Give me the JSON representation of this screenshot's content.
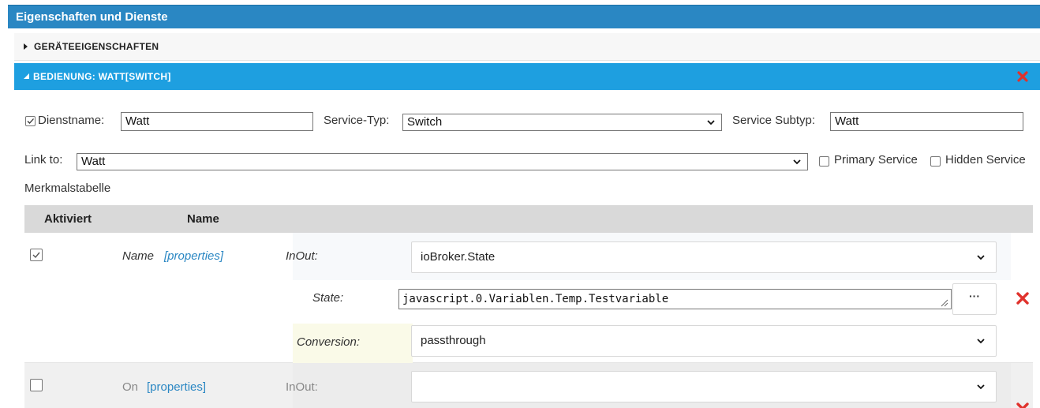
{
  "window": {
    "title": "Eigenschaften und Dienste"
  },
  "accordion": {
    "collapsed_label": "GERÄTEEIGENSCHAFTEN",
    "open_label": "BEDIENUNG: WATT[SWITCH]"
  },
  "service": {
    "enabled": true,
    "dienstname_label": "Dienstname:",
    "dienstname_value": "Watt",
    "service_typ_label": "Service-Typ:",
    "service_typ_value": "Switch",
    "service_subtyp_label": "Service Subtyp:",
    "service_subtyp_value": "Watt",
    "link_to_label": "Link to:",
    "link_to_value": "Watt",
    "primary_label": "Primary Service",
    "primary_checked": false,
    "hidden_label": "Hidden Service",
    "hidden_checked": false
  },
  "table": {
    "title": "Merkmalstabelle",
    "headers": {
      "activated": "Aktiviert",
      "name": "Name"
    },
    "rows": [
      {
        "activated": true,
        "name": "Name",
        "props_link": "[properties]",
        "inout_label": "InOut:",
        "inout_value": "ioBroker.State",
        "state_label": "State:",
        "state_value": "javascript.0.Variablen.Temp.Testvariable",
        "dots_label": "···",
        "conversion_label": "Conversion:",
        "conversion_value": "passthrough"
      },
      {
        "activated": false,
        "name": "On",
        "props_link": "[properties]",
        "inout_label": "InOut:",
        "inout_value": ""
      }
    ]
  },
  "colors": {
    "titlebar": "#2a87c3",
    "accordion_open": "#1e9fe0",
    "remove_red": "#e0322c",
    "link": "#2a87c3"
  }
}
